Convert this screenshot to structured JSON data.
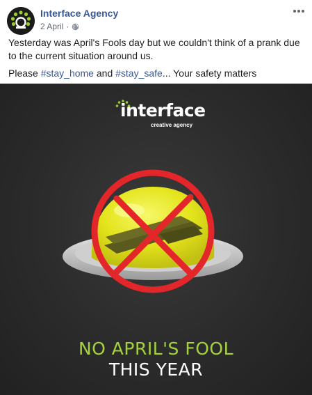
{
  "post": {
    "author": "Interface Agency",
    "date": "2 April",
    "separator": "·",
    "privacy_icon": "globe-icon",
    "more_icon": "more-options-icon",
    "text_line1": "Yesterday was April's Fools day but we couldn't think of a prank due to the current situation around us.",
    "text_line2_prefix": "Please ",
    "hashtag1": "#stay_home",
    "text_line2_and": " and ",
    "hashtag2": "#stay_safe",
    "text_line2_suffix": "... Your safety matters"
  },
  "image": {
    "logo_word": "interface",
    "logo_tagline": "creative agency",
    "headline_line1": "NO APRIL'S FOOL",
    "headline_line2": "THIS YEAR"
  },
  "colors": {
    "link": "#385898",
    "accent_green": "#a6d23a",
    "prohibited_red": "#e3262a",
    "jelly_yellow": "#e6e61a"
  }
}
